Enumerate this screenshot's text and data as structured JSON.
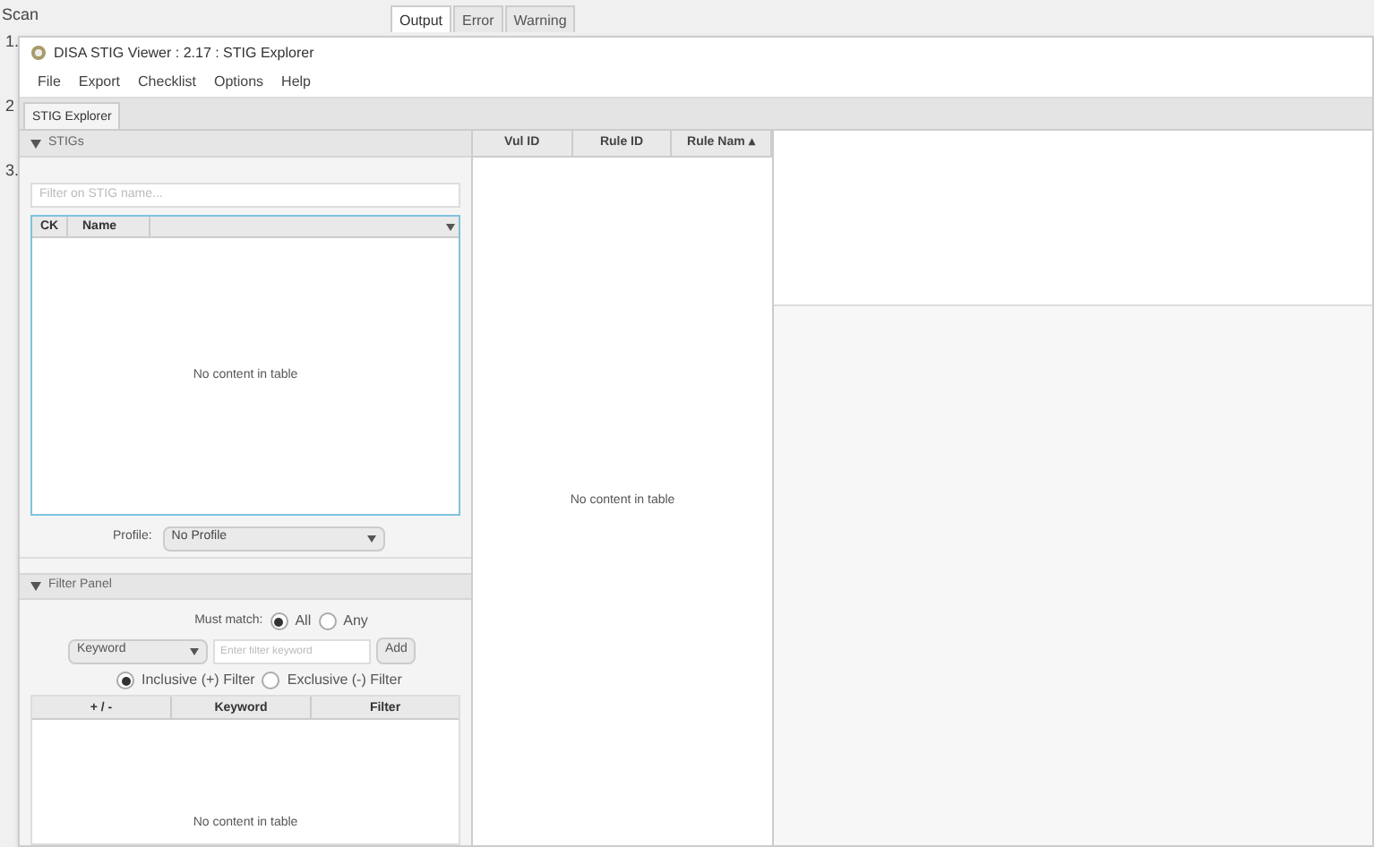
{
  "background_app": {
    "title": "Scan",
    "steps": [
      "1.",
      "2",
      "3."
    ],
    "tabs": [
      {
        "label": "Output",
        "selected": true
      },
      {
        "label": "Error",
        "selected": false
      },
      {
        "label": "Warning",
        "selected": false
      }
    ]
  },
  "window": {
    "title": "DISA STIG Viewer : 2.17 : STIG Explorer"
  },
  "menu": [
    "File",
    "Export",
    "Checklist",
    "Options",
    "Help"
  ],
  "tabs": [
    {
      "label": "STIG Explorer",
      "selected": true
    }
  ],
  "stigs_panel": {
    "title": "STIGs",
    "expanded": true,
    "filter": {
      "placeholder": "Filter on STIG name..."
    },
    "columns": [
      "CK",
      "Name"
    ],
    "empty": "No content in table",
    "profile_label": "Profile:",
    "profile": "No Profile"
  },
  "filter_panel": {
    "title": "Filter Panel",
    "expanded": true,
    "must_match_label": "Must match:",
    "match_options": [
      {
        "label": "All",
        "selected": true
      },
      {
        "label": "Any",
        "selected": false
      }
    ],
    "field_type": "Keyword",
    "keyword": {
      "placeholder": "Enter filter keyword"
    },
    "add_button": "Add",
    "filter_modes": [
      {
        "label": "Inclusive (+) Filter",
        "selected": true
      },
      {
        "label": "Exclusive (-) Filter",
        "selected": false
      }
    ],
    "columns": [
      "+ / -",
      "Keyword",
      "Filter"
    ],
    "empty": "No content in table"
  },
  "rules_table": {
    "columns": [
      "Vul ID",
      "Rule ID",
      "Rule Nam"
    ],
    "sort_indicator": "▴",
    "empty": "No content in table"
  }
}
